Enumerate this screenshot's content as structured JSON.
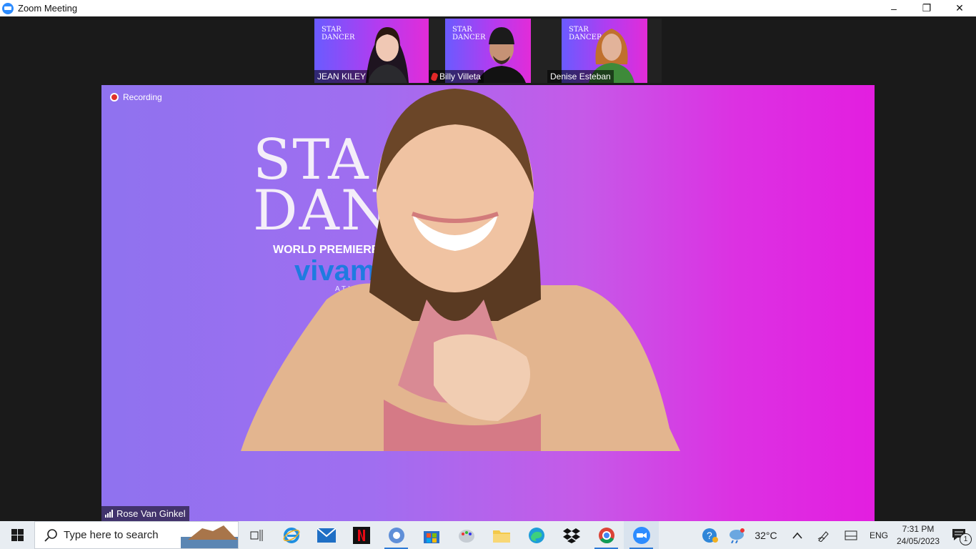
{
  "window": {
    "title": "Zoom Meeting",
    "controls": {
      "minimize": "–",
      "restore": "❐",
      "close": "✕"
    }
  },
  "participants": [
    {
      "name": "JEAN KILEY",
      "muted": false
    },
    {
      "name": "Billy Villeta",
      "muted": true
    },
    {
      "name": "Denise Esteban",
      "muted": false
    }
  ],
  "thumb_logo": {
    "line1": "STAR",
    "line2": "DANCER"
  },
  "main_video": {
    "recording_label": "Recording",
    "speaker_name": "Rose Van Ginkel",
    "poster": {
      "line1": "STA",
      "line2": "DANC",
      "line3": "WORLD PREMIERE on",
      "line4": "vivam",
      "line5": "ATIN 'TO"
    }
  },
  "taskbar": {
    "search_placeholder": "Type here to search",
    "weather_temp": "32°C",
    "language": "ENG",
    "time": "7:31 PM",
    "date": "24/05/2023",
    "notification_count": "1"
  },
  "colors": {
    "zoom_blue": "#2d8cff",
    "video_purple": "#8f72ef",
    "video_magenta": "#e31ee0",
    "recording_red": "#e0312b"
  }
}
